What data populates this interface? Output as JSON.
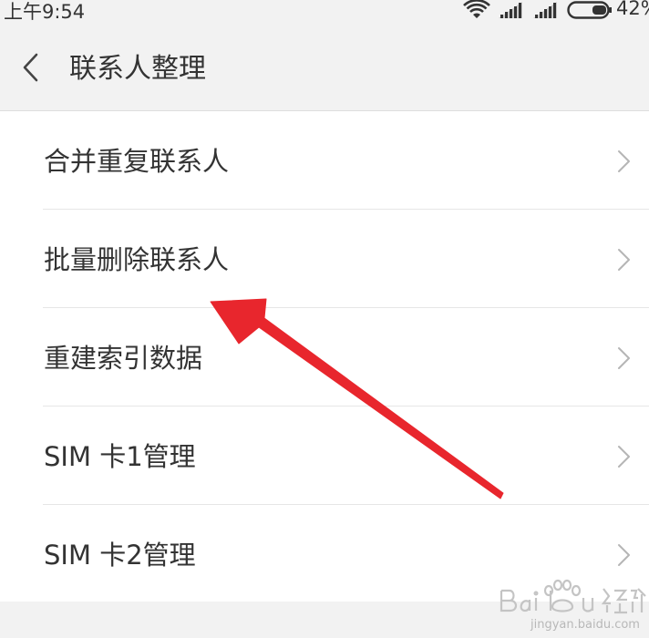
{
  "status_bar": {
    "time": "上午9:54",
    "battery_percent": "42%",
    "icons": [
      "wifi-icon",
      "signal-icon",
      "signal-icon",
      "battery-icon"
    ]
  },
  "header": {
    "back_icon": "chevron-left-icon",
    "title": "联系人整理"
  },
  "menu": {
    "items": [
      {
        "label": "合并重复联系人"
      },
      {
        "label": "批量删除联系人"
      },
      {
        "label": "重建索引数据"
      },
      {
        "label": "SIM 卡1管理"
      },
      {
        "label": "SIM 卡2管理"
      }
    ],
    "chevron_icon": "chevron-right-icon"
  },
  "annotation": {
    "color": "#e8262d"
  },
  "watermark": {
    "logo_text": "Bai du 经验",
    "url": "jingyan.baidu.com"
  },
  "colors": {
    "background": "#ffffff",
    "header_bg": "#f2f2f2",
    "text": "#333333",
    "divider": "#e6e6e6",
    "chevron": "#b5b5b5"
  }
}
